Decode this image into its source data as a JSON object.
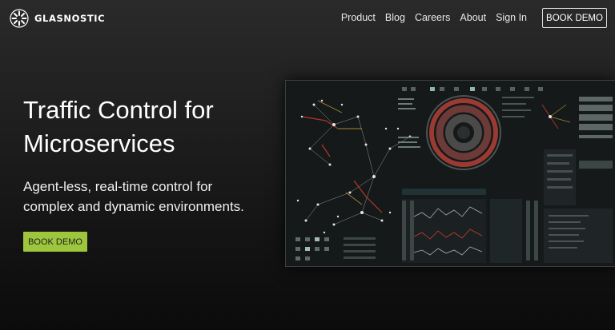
{
  "brand": {
    "name": "GLASNOSTIC"
  },
  "nav": {
    "items": [
      "Product",
      "Blog",
      "Careers",
      "About",
      "Sign In"
    ],
    "cta": "BOOK DEMO"
  },
  "hero": {
    "title_line1": "Traffic Control for",
    "title_line2": "Microservices",
    "subtitle_line1": "Agent-less, real-time control for",
    "subtitle_line2": "complex and dynamic environments.",
    "cta": "BOOK DEMO"
  },
  "colors": {
    "accent": "#9dc63c",
    "background": "#1c1c1c"
  },
  "icons": {
    "logo": "glasnostic-burst-icon"
  }
}
